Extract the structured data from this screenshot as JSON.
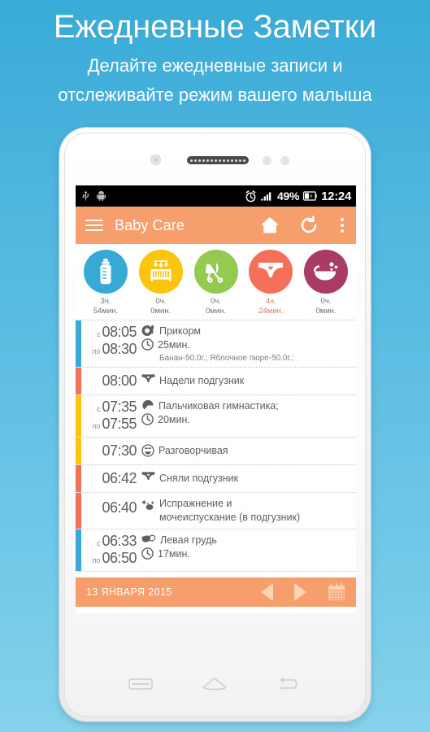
{
  "promo": {
    "title": "Ежедневные Заметки",
    "subtitle_line1": "Делайте ежедневные записи и",
    "subtitle_line2": "отслеживайте режим вашего малыша"
  },
  "statusbar": {
    "icons": [
      "usb-icon",
      "android-icon",
      "alarm-icon",
      "signal-icon",
      "battery-icon"
    ],
    "battery_percent": "49%",
    "time": "12:24"
  },
  "appbar": {
    "menu_icon": "hamburger-icon",
    "title": "Baby Care",
    "home_icon": "home-icon",
    "refresh_icon": "refresh-icon",
    "overflow_icon": "overflow-menu-icon",
    "background": "#f79f6c"
  },
  "summary": {
    "items": [
      {
        "icon": "baby-bottle-icon",
        "color": "#36a9d6",
        "hours": "3ч.",
        "minutes": "54мин.",
        "highlight": false
      },
      {
        "icon": "crib-icon",
        "color": "#fdc40b",
        "hours": "0ч.",
        "minutes": "0мин.",
        "highlight": false
      },
      {
        "icon": "stroller-icon",
        "color": "#96c94f",
        "hours": "0ч.",
        "minutes": "0мин.",
        "highlight": false
      },
      {
        "icon": "diaper-icon",
        "color": "#f4705a",
        "hours": "4ч.",
        "minutes": "24мин.",
        "highlight": true
      },
      {
        "icon": "bath-icon",
        "color": "#a93c65",
        "hours": "0ч.",
        "minutes": "0мин.",
        "highlight": false
      }
    ]
  },
  "events": [
    {
      "bar_color": "blue",
      "start_prefix": "с",
      "start_time": "08:05",
      "end_prefix": "по",
      "end_time": "08:30",
      "icon": "food-bowl-icon",
      "title": "Прикорм",
      "duration_icon": "clock-icon",
      "duration": "25мин.",
      "detail": "Банан-50.0г.; Яблочное пюре-50.0г.;"
    },
    {
      "bar_color": "orange",
      "start_prefix": "",
      "start_time": "08:00",
      "end_prefix": "",
      "end_time": "",
      "icon": "diaper-icon",
      "title": "Надели подгузник",
      "duration_icon": "",
      "duration": "",
      "detail": ""
    },
    {
      "bar_color": "yellow",
      "start_prefix": "с",
      "start_time": "07:35",
      "end_prefix": "по",
      "end_time": "07:55",
      "icon": "activity-icon",
      "title": "Пальчиковая гимнастика;",
      "duration_icon": "clock-icon",
      "duration": "20мин.",
      "detail": ""
    },
    {
      "bar_color": "yellow",
      "start_prefix": "",
      "start_time": "07:30",
      "end_prefix": "",
      "end_time": "",
      "icon": "smiley-icon",
      "title": "Разговорчивая",
      "duration_icon": "",
      "duration": "",
      "detail": ""
    },
    {
      "bar_color": "orange",
      "start_prefix": "",
      "start_time": "06:42",
      "end_prefix": "",
      "end_time": "",
      "icon": "diaper-icon",
      "title": "Сняли подгузник",
      "duration_icon": "",
      "duration": "",
      "detail": ""
    },
    {
      "bar_color": "orange",
      "start_prefix": "",
      "start_time": "06:40",
      "end_prefix": "",
      "end_time": "",
      "icon": "poop-icon",
      "title": "Испражнение и",
      "title_line2": "мочеиспускание (в подгузник)",
      "duration_icon": "",
      "duration": "",
      "detail": ""
    },
    {
      "bar_color": "blue",
      "start_prefix": "с",
      "start_time": "06:33",
      "end_prefix": "по",
      "end_time": "06:50",
      "icon": "breast-icon",
      "title": "Левая грудь",
      "duration_icon": "clock-icon",
      "duration": "17мин.",
      "detail": ""
    }
  ],
  "datebar": {
    "date": "13 ЯНВАРЯ 2015",
    "prev_icon": "prev-arrow-icon",
    "next_icon": "next-arrow-icon",
    "calendar_icon": "calendar-icon",
    "background": "#f79f6c"
  },
  "device_nav": {
    "menu_icon": "android-menu-icon",
    "home_icon": "android-home-icon",
    "back_icon": "android-back-icon"
  }
}
